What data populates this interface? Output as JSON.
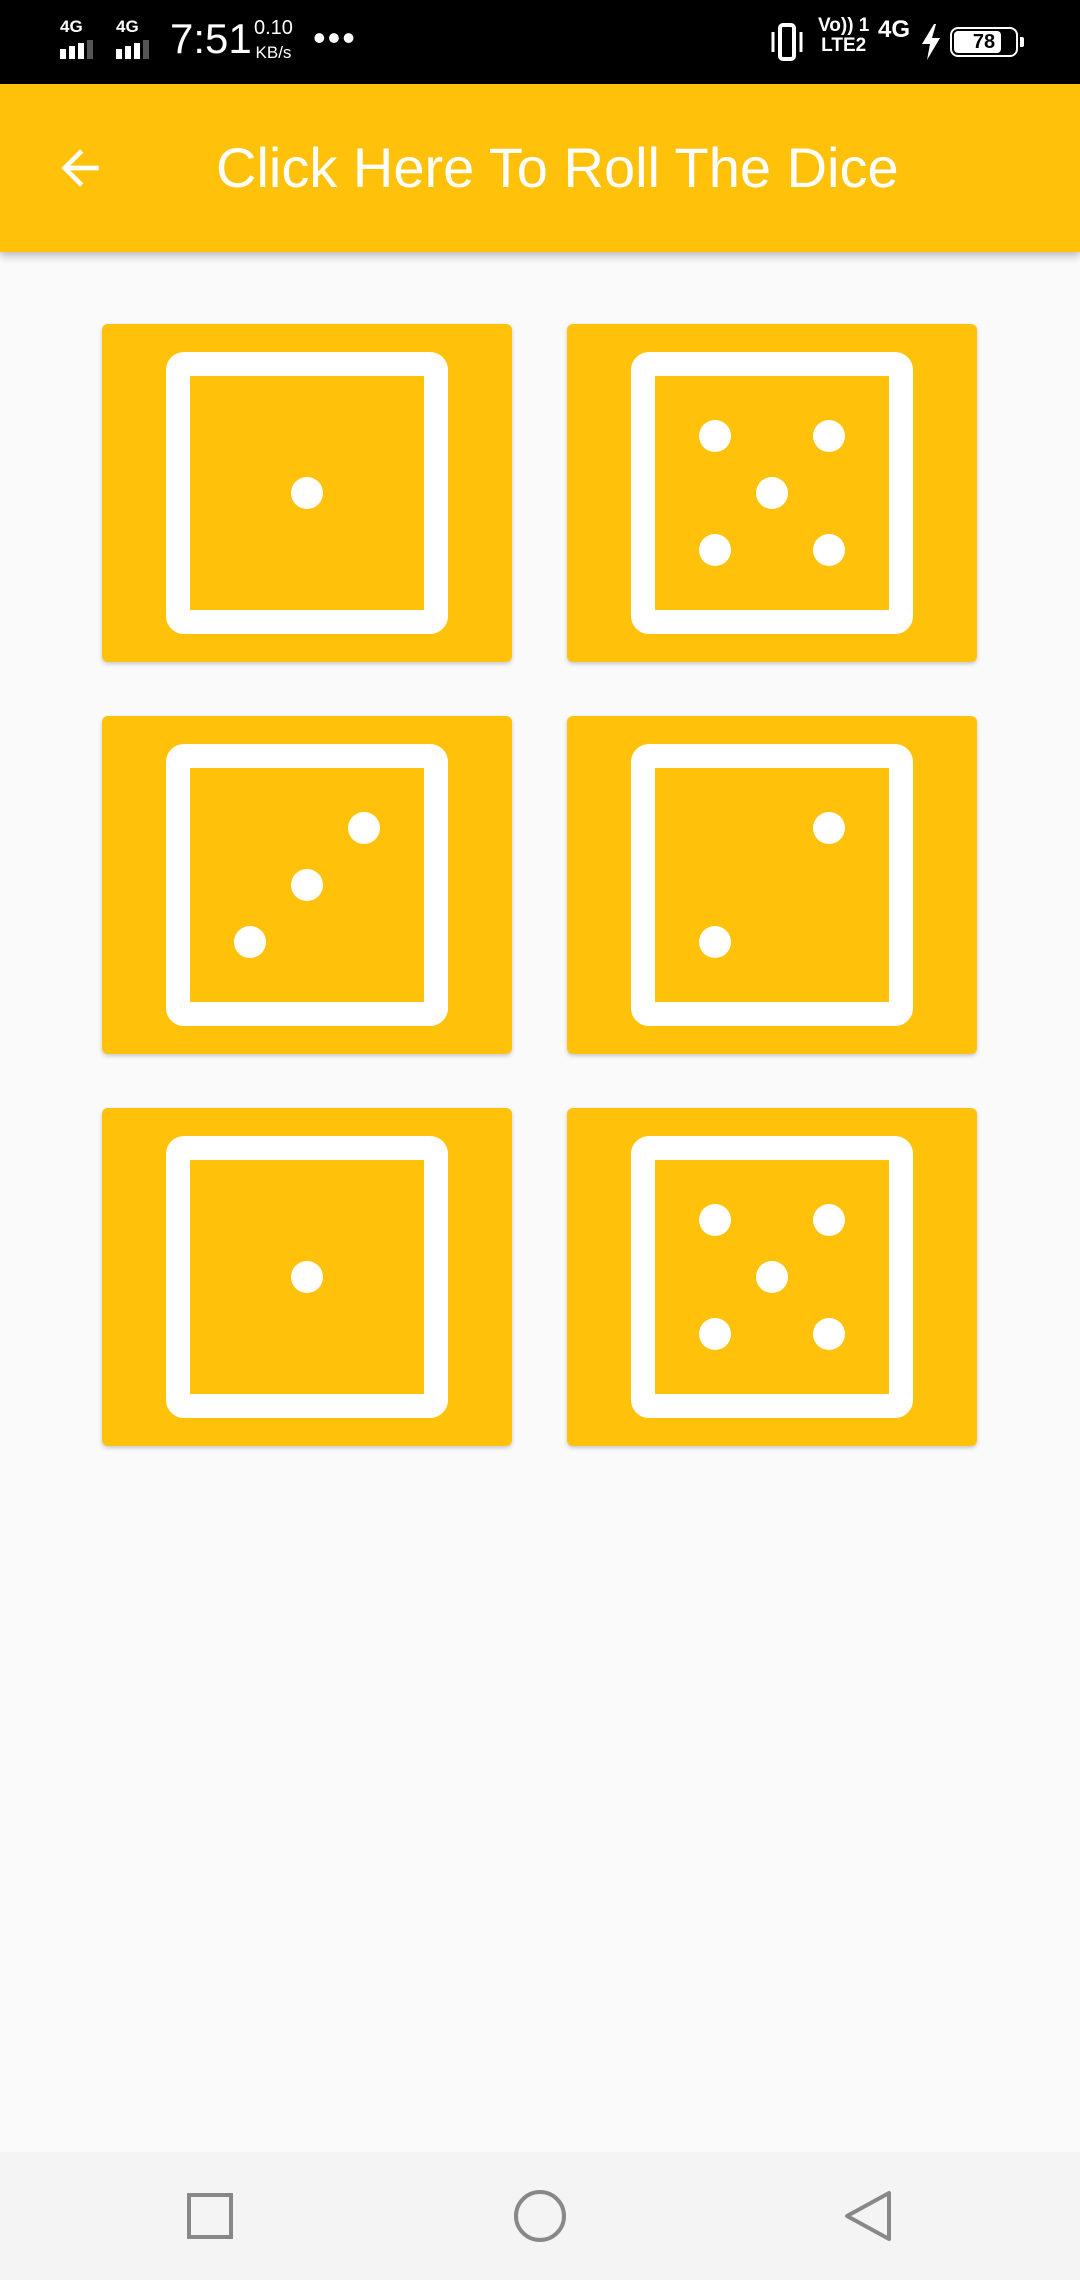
{
  "status_bar": {
    "network1": "4G",
    "network2": "4G",
    "time": "7:51",
    "speed_value": "0.10",
    "speed_unit": "KB/s",
    "overflow": "•••",
    "volte_line1": "Vo)) 1",
    "volte_line2": "LTE2",
    "network3": "4G",
    "battery": "78"
  },
  "app_bar": {
    "title": "Click Here To Roll The Dice",
    "back_icon": "arrow-back-icon",
    "color": "#ffc10a"
  },
  "dice": [
    {
      "value": 1
    },
    {
      "value": 5
    },
    {
      "value": 3
    },
    {
      "value": 2
    },
    {
      "value": 1
    },
    {
      "value": 5
    }
  ],
  "nav_bar": {
    "recents_icon": "square-icon",
    "home_icon": "circle-icon",
    "back_icon": "triangle-back-icon"
  }
}
